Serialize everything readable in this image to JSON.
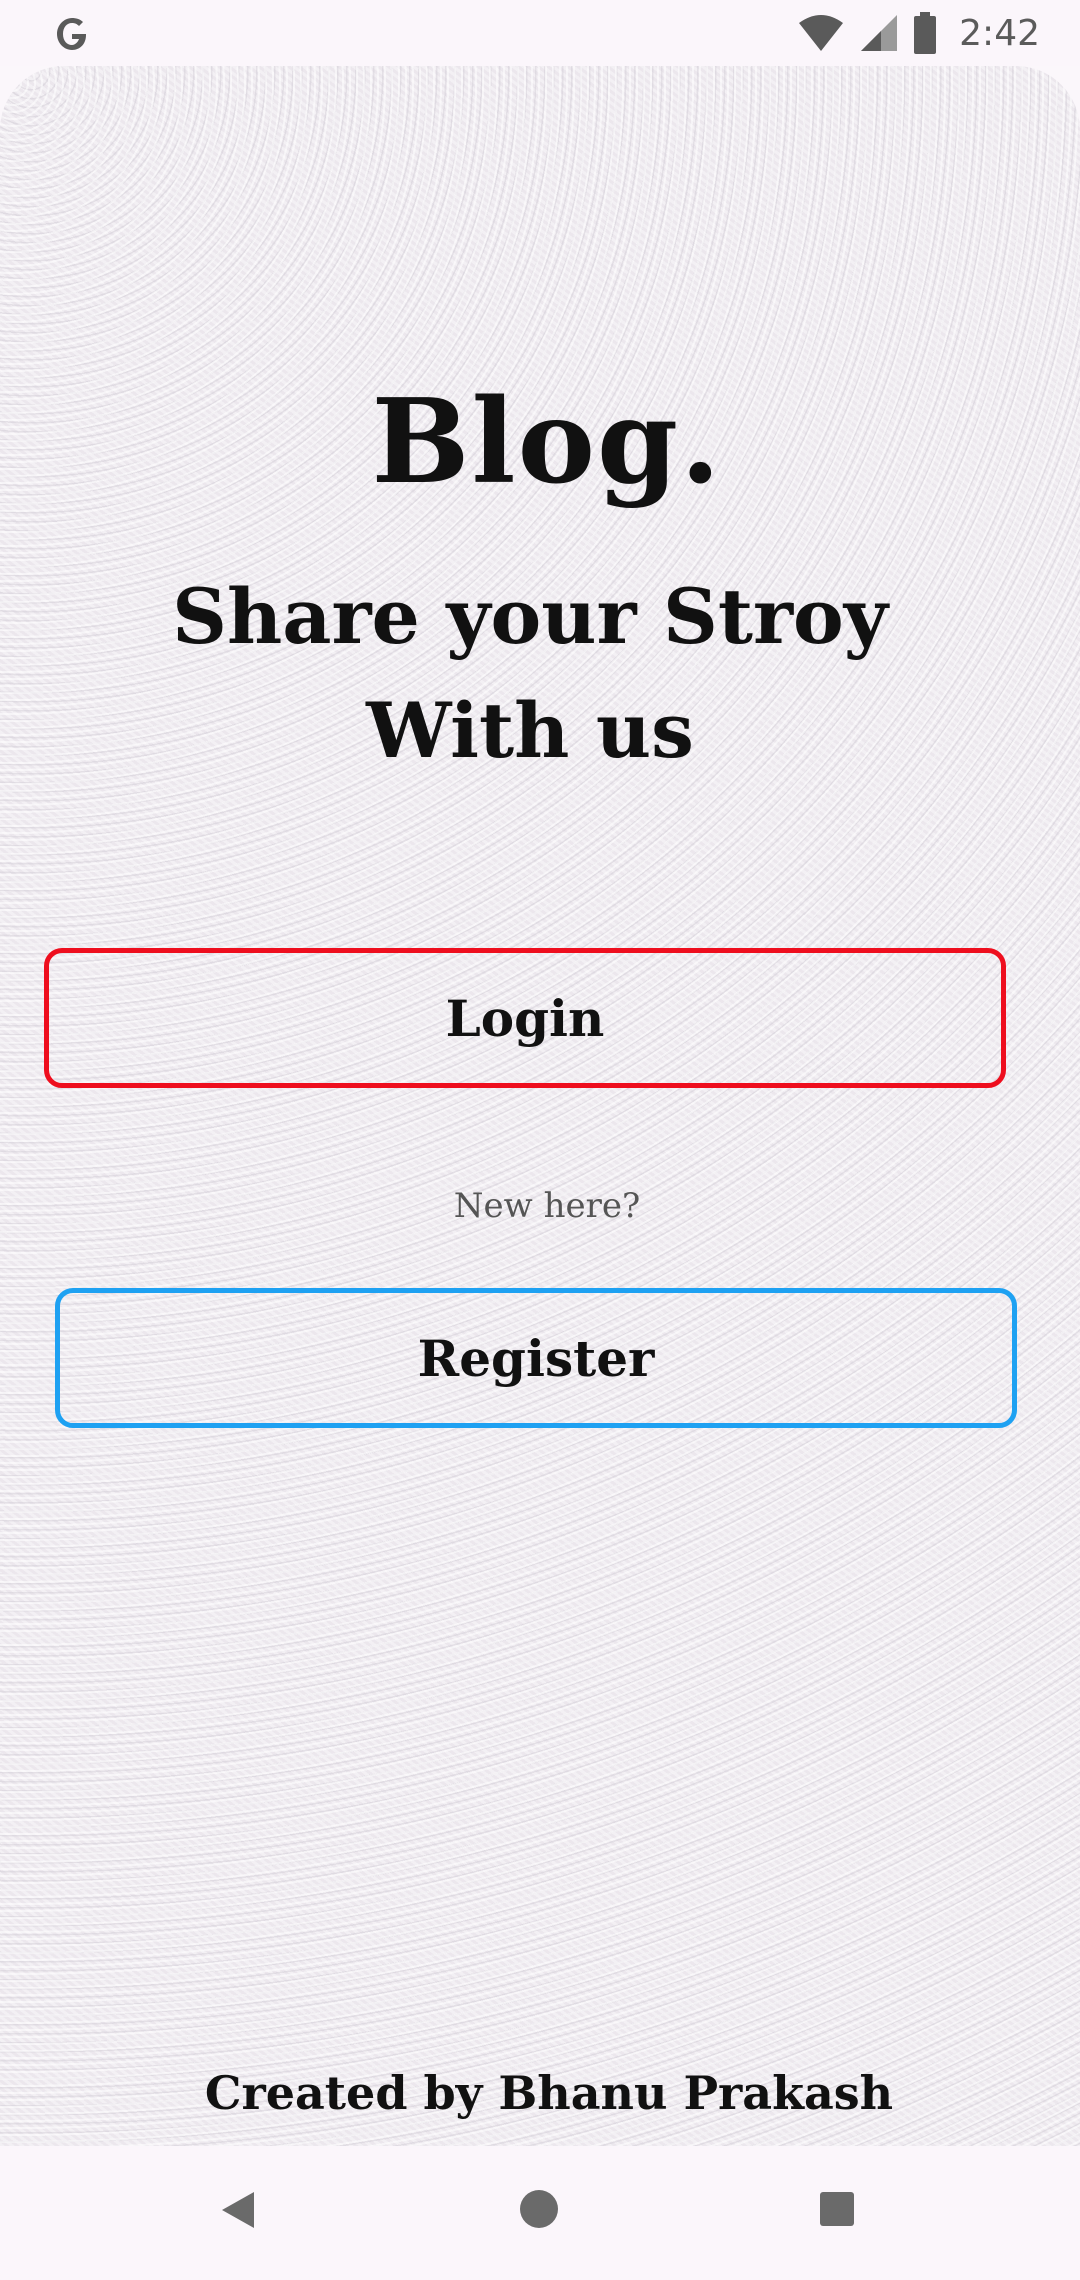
{
  "status_bar": {
    "time": "2:42",
    "icons": [
      "google-icon",
      "wifi-icon",
      "signal-icon",
      "battery-icon"
    ]
  },
  "main": {
    "brand": "Blog.",
    "tagline_line1": "Share your Stroy",
    "tagline_line2": "With us",
    "login_label": "Login",
    "new_here": "New here?",
    "register_label": "Register",
    "credit": "Created by Bhanu Prakash"
  },
  "colors": {
    "login_border": "#ee0e1e",
    "register_border": "#1ea1f2",
    "text": "#111111"
  },
  "nav_bar": {
    "icons": [
      "back-icon",
      "home-icon",
      "recents-icon"
    ]
  }
}
